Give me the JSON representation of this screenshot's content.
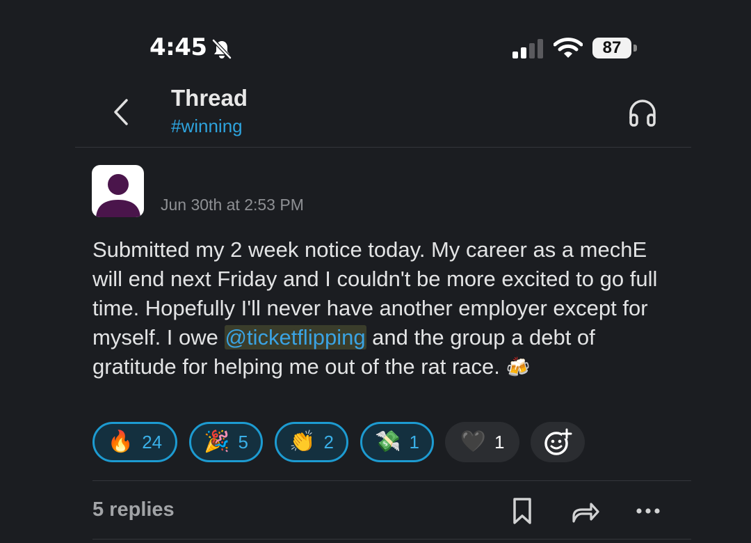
{
  "status_bar": {
    "time": "4:45",
    "battery": "87"
  },
  "header": {
    "title": "Thread",
    "channel": "#winning"
  },
  "message": {
    "timestamp": "Jun 30th at 2:53 PM",
    "text_before_mention": "Submitted my 2 week notice today. My career as a mechE will end next Friday and I couldn't be more excited to go full time. Hopefully I'll never have another employer except for myself. I owe ",
    "mention": "@ticketflipping",
    "text_after_mention": " and the group a debt of gratitude for helping me out of the rat race. ",
    "trailing_emoji": "🍻"
  },
  "reactions": [
    {
      "emoji": "🔥",
      "count": "24",
      "selected": true
    },
    {
      "emoji": "🎉",
      "count": "5",
      "selected": true
    },
    {
      "emoji": "👏",
      "count": "2",
      "selected": true
    },
    {
      "emoji": "💸",
      "count": "1",
      "selected": true
    },
    {
      "emoji": "🖤",
      "count": "1",
      "selected": false
    }
  ],
  "footer": {
    "replies": "5 replies"
  },
  "icons": [
    "bell-slash-icon",
    "cellular-signal-icon",
    "wifi-icon",
    "battery-icon",
    "back-chevron-icon",
    "headphones-icon",
    "add-reaction-icon",
    "bookmark-icon",
    "share-icon",
    "more-icon"
  ],
  "colors": {
    "background": "#1b1d21",
    "link": "#2ea3dd",
    "reaction_border": "#1d9bd1",
    "avatar_purple": "#4a154b"
  }
}
